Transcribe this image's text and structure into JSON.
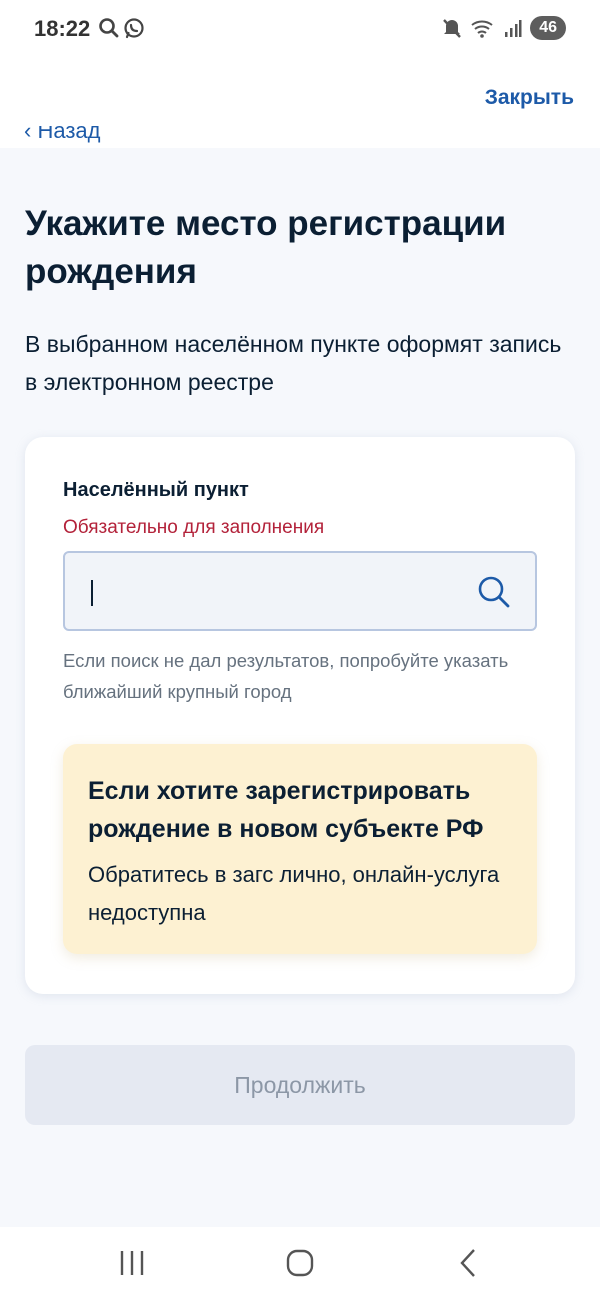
{
  "status_bar": {
    "time": "18:22",
    "battery": "46",
    "left_icons": [
      "search-icon",
      "whatsapp-icon"
    ],
    "right_icons": [
      "mute-icon",
      "wifi-icon",
      "signal-icon"
    ]
  },
  "header": {
    "close_label": "Закрыть",
    "back_label": "Назад"
  },
  "page": {
    "title": "Укажите место регистрации рождения",
    "subtitle": "В выбранном населённом пункте оформят запись в электронном реестре"
  },
  "form": {
    "field_label": "Населённый пункт",
    "required_text": "Обязательно для заполнения",
    "input_value": "",
    "hint": "Если поиск не дал результатов, попробуйте указать ближайший крупный город"
  },
  "notice": {
    "title": "Если хотите зарегистрировать рождение в новом субъекте РФ",
    "text": "Обратитесь в загс лично, онлайн-услуга недоступна",
    "background": "#fdf1d2"
  },
  "actions": {
    "continue_label": "Продолжить"
  },
  "colors": {
    "link": "#1d5aa8",
    "required": "#b3223a",
    "disabled_button": "#e5e9f2"
  }
}
